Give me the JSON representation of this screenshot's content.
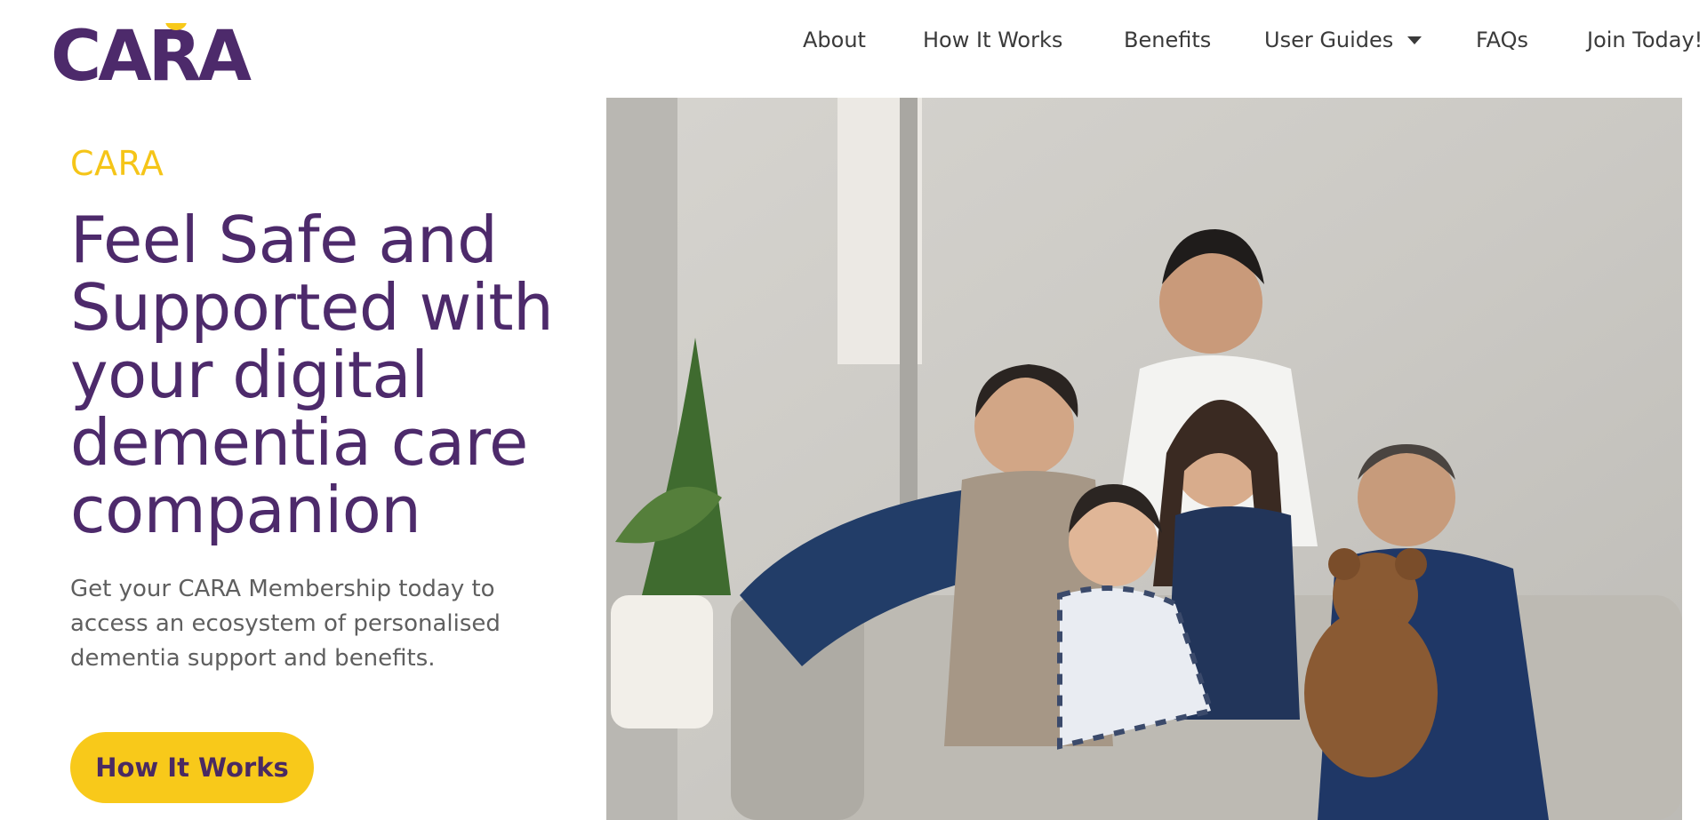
{
  "brand": {
    "logo_text": "CARA"
  },
  "nav": {
    "items": [
      {
        "label": "About"
      },
      {
        "label": "How It Works"
      },
      {
        "label": "Benefits"
      },
      {
        "label": "User Guides"
      },
      {
        "label": "FAQs"
      },
      {
        "label": "Join Today!"
      }
    ]
  },
  "hero": {
    "eyebrow": "CARA",
    "headline_lines": [
      "Feel Safe and",
      "Supported with",
      "your digital",
      "dementia care",
      "companion"
    ],
    "subtext_lines": [
      "Get your CARA Membership today to",
      "access an ecosystem of personalised",
      "dementia support and benefits."
    ],
    "cta_label": "How It Works",
    "image_alt": "Family of five laughing together on a sofa with a teddy bear"
  },
  "colors": {
    "brand_purple": "#4d2a6b",
    "accent_yellow": "#f8c91a",
    "eyebrow_yellow": "#f5c518"
  },
  "icons": {
    "dropdown": "caret-down-icon"
  }
}
